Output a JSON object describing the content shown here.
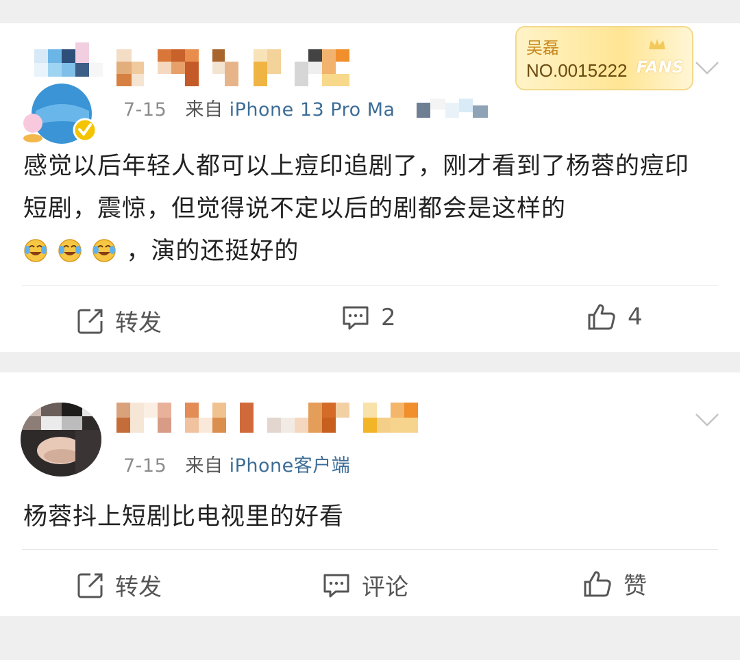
{
  "posts": [
    {
      "date": "7-15",
      "source_prefix": "来自",
      "device": "iPhone 13 Pro Ma",
      "fan_badge": {
        "name": "吴磊",
        "number": "NO.0015222",
        "fans_label": "FANS"
      },
      "content_text": "感觉以后年轻人都可以上痘印追剧了，刚才看到了杨蓉的痘印短剧，震惊，但觉得说不定以后的剧都会是这样的",
      "content_tail": "，演的还挺好的",
      "actions": {
        "repost": "转发",
        "comment": "2",
        "like": "4"
      }
    },
    {
      "date": "7-15",
      "source_prefix": "来自",
      "device": "iPhone客户端",
      "content_text": "杨蓉抖上短剧比电视里的好看",
      "actions": {
        "repost": "转发",
        "comment": "评论",
        "like": "赞"
      }
    }
  ],
  "colors": {
    "background": "#efefef",
    "card": "#ffffff",
    "link": "#3d6d96",
    "meta": "#8c8c8c"
  }
}
